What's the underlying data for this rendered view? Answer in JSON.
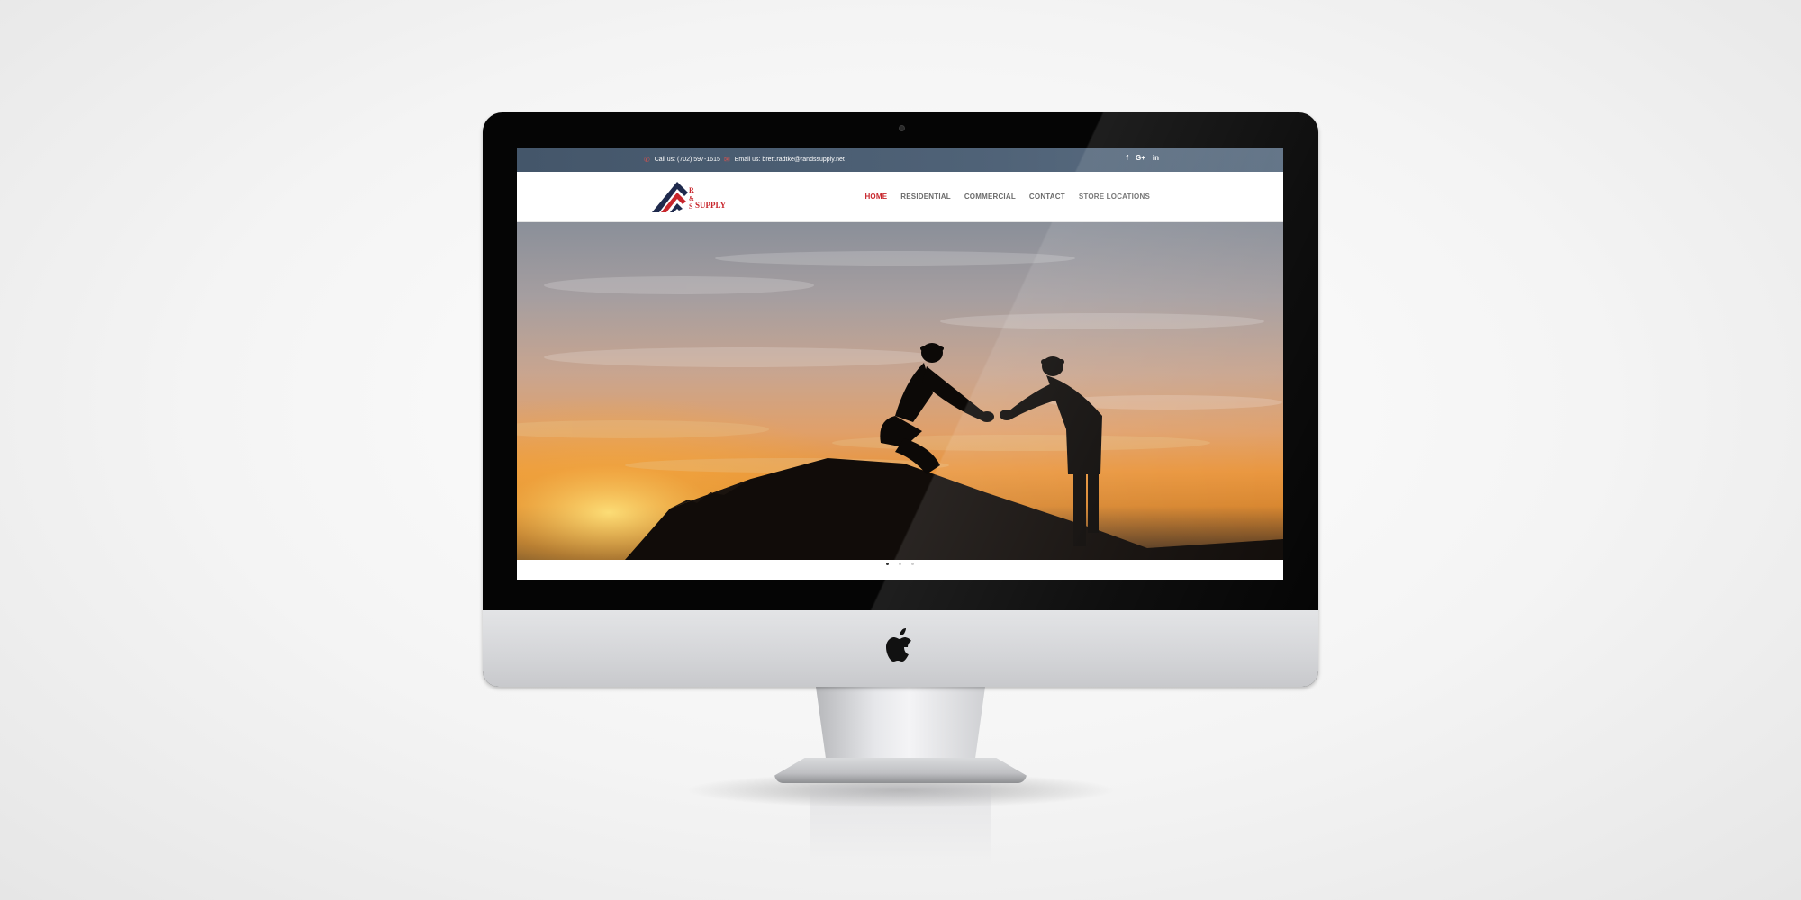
{
  "topbar": {
    "phone_icon": "phone-icon",
    "phone_text": "Call us: (702) 597-1615",
    "email_icon": "envelope-icon",
    "email_text": "Email us: brett.radtke@randssupply.net",
    "social": [
      {
        "icon": "facebook-icon",
        "glyph": "f"
      },
      {
        "icon": "google-plus-icon",
        "glyph": "G+"
      },
      {
        "icon": "linkedin-icon",
        "glyph": "in"
      }
    ]
  },
  "logo": {
    "letters": [
      "R",
      "&",
      "S"
    ],
    "word": "SUPPLY",
    "colors": {
      "navy": "#1f2a4d",
      "red": "#c8262c"
    }
  },
  "nav": {
    "items": [
      "HOME",
      "RESIDENTIAL",
      "COMMERCIAL",
      "CONTACT",
      "STORE LOCATIONS"
    ],
    "active_index": 0
  },
  "hero": {
    "image": "silhouette of two roofers shaking hands on a rooftop at sunset"
  },
  "slider": {
    "slide_count": 3,
    "active_index": 0
  },
  "device": {
    "type": "desktop monitor mockup",
    "logo_icon": "apple-logo-icon"
  },
  "colors": {
    "accent": "#c8262c",
    "topbar": "#4f6277",
    "nav_text": "#6b6b6b"
  }
}
